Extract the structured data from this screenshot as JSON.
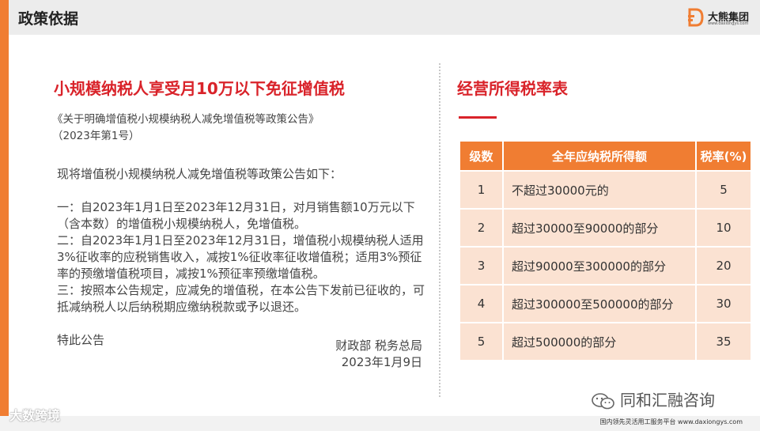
{
  "header": {
    "title": "政策依据",
    "logo_text": "大熊集团",
    "logo_url": "www.daxiongys.com"
  },
  "left": {
    "title": "小规模纳税人享受月10万以下免征增值税",
    "doc_name": "《关于明确增值税小规模纳税人减免增值税等政策公告》",
    "doc_number": "（2023年第1号）",
    "intro": "现将增值税小规模纳税人减免增值税等政策公告如下：",
    "clause_1": "一：自2023年1月1日至2023年12月31日，对月销售额10万元以下（含本数）的增值税小规模纳税人，免增值税。",
    "clause_2": "二：自2023年1月1日至2023年12月31日，增值税小规模纳税人适用3%征收率的应税销售收入，减按1%征收率征收增值税；适用3%预征率的预缴增值税项目，减按1%预征率预缴增值税。",
    "clause_3": "三：按照本公告规定，应减免的增值税，在本公告下发前已征收的，可抵减纳税人以后纳税期应缴纳税款或予以退还。",
    "closing": "特此公告",
    "signature": "财政部 税务总局",
    "date": "2023年1月9日"
  },
  "right": {
    "title": "经营所得税率表",
    "table": {
      "headers": [
        "级数",
        "全年应纳税所得额",
        "税率(%)"
      ],
      "rows": [
        [
          "1",
          "不超过30000元的",
          "5"
        ],
        [
          "2",
          "超过30000至90000的部分",
          "10"
        ],
        [
          "3",
          "超过90000至300000的部分",
          "20"
        ],
        [
          "4",
          "超过300000至500000的部分",
          "30"
        ],
        [
          "5",
          "超过500000的部分",
          "35"
        ]
      ]
    }
  },
  "footer": {
    "wechat_name": "同和汇融咨询",
    "tagline": "国内领先灵活用工服务平台 www.daxiongys.com",
    "watermark": "大数跨境"
  },
  "colors": {
    "accent_orange": "#f07d32",
    "title_red": "#d9232a",
    "table_row_bg": "#fbe2d2"
  }
}
